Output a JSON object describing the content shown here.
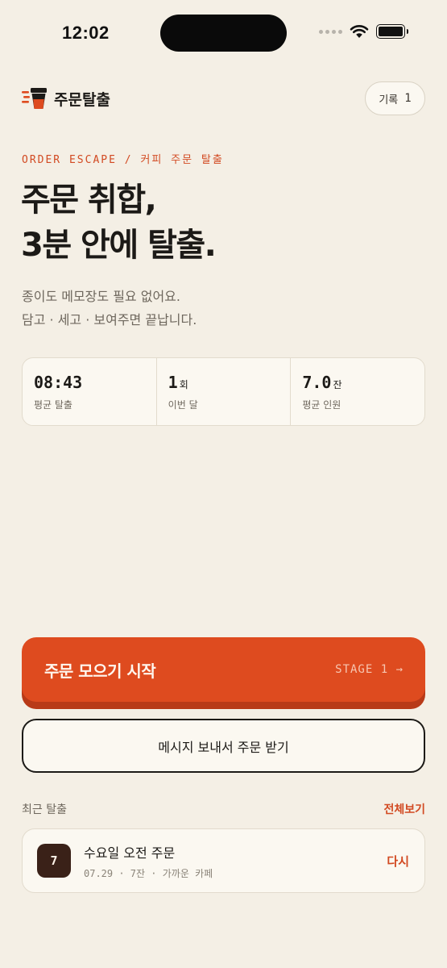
{
  "status_bar": {
    "time": "12:02"
  },
  "header": {
    "brand": "주문탈출",
    "record_label": "기록",
    "record_count": "1"
  },
  "hero": {
    "eyebrow": "ORDER ESCAPE / 커피 주문 탈출",
    "title_line1": "주문 취합,",
    "title_line2": "3분 안에 탈출.",
    "subtitle_line1": "종이도 메모장도 필요 없어요.",
    "subtitle_line2": "담고 · 세고 · 보여주면 끝납니다."
  },
  "stats": [
    {
      "value": "08:43",
      "unit": "",
      "label": "평균 탈출"
    },
    {
      "value": "1",
      "unit": "회",
      "label": "이번 달"
    },
    {
      "value": "7.0",
      "unit": "잔",
      "label": "평균 인원"
    }
  ],
  "cta": {
    "label": "주문 모으기 시작",
    "stage": "STAGE 1 →"
  },
  "message_button": "메시지 보내서 주문 받기",
  "recent": {
    "title": "최근 탈출",
    "see_all": "전체보기",
    "items": [
      {
        "badge": "7",
        "name": "수요일 오전 주문",
        "meta": "07.29 · 7잔 · 가까운 카페",
        "action": "다시"
      }
    ]
  },
  "colors": {
    "accent": "#de4b1f",
    "background": "#f4efe5",
    "ink": "#1c1a17"
  }
}
